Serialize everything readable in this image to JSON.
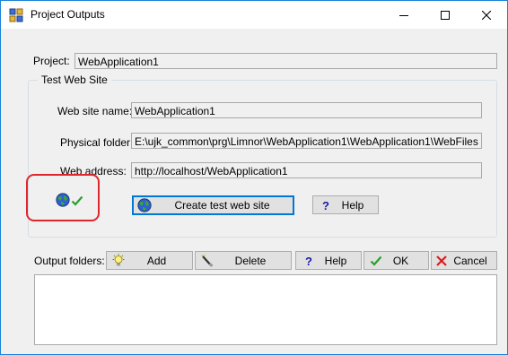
{
  "window": {
    "title": "Project Outputs",
    "controls": [
      "minimize-icon",
      "maximize-icon",
      "close-icon"
    ]
  },
  "project": {
    "label": "Project:",
    "value": "WebApplication1"
  },
  "test_site": {
    "group_label": "Test Web Site",
    "site_name_label": "Web site name:",
    "site_name_value": "WebApplication1",
    "physical_folder_label": "Physical folder:",
    "physical_folder_value": "E:\\ujk_common\\prg\\Limnor\\WebApplication1\\WebApplication1\\WebFiles",
    "web_address_label": "Web address:",
    "web_address_value": "http://localhost/WebApplication1",
    "status_icons": [
      "globe-icon",
      "checkmark-icon"
    ],
    "create_button": "Create test web site",
    "help_button": "Help",
    "help_icon_glyph": "?"
  },
  "output": {
    "label": "Output folders:",
    "add_button": "Add",
    "delete_button": "Delete",
    "help_button": "Help",
    "help_icon_glyph": "?",
    "ok_button": "OK",
    "cancel_button": "Cancel",
    "items": []
  },
  "colors": {
    "accent": "#0078d7",
    "highlight_mark": "#e0262d",
    "ok_check": "#2aa02a",
    "cancel_x": "#d81e1e",
    "help_q": "#1a1aa6"
  }
}
